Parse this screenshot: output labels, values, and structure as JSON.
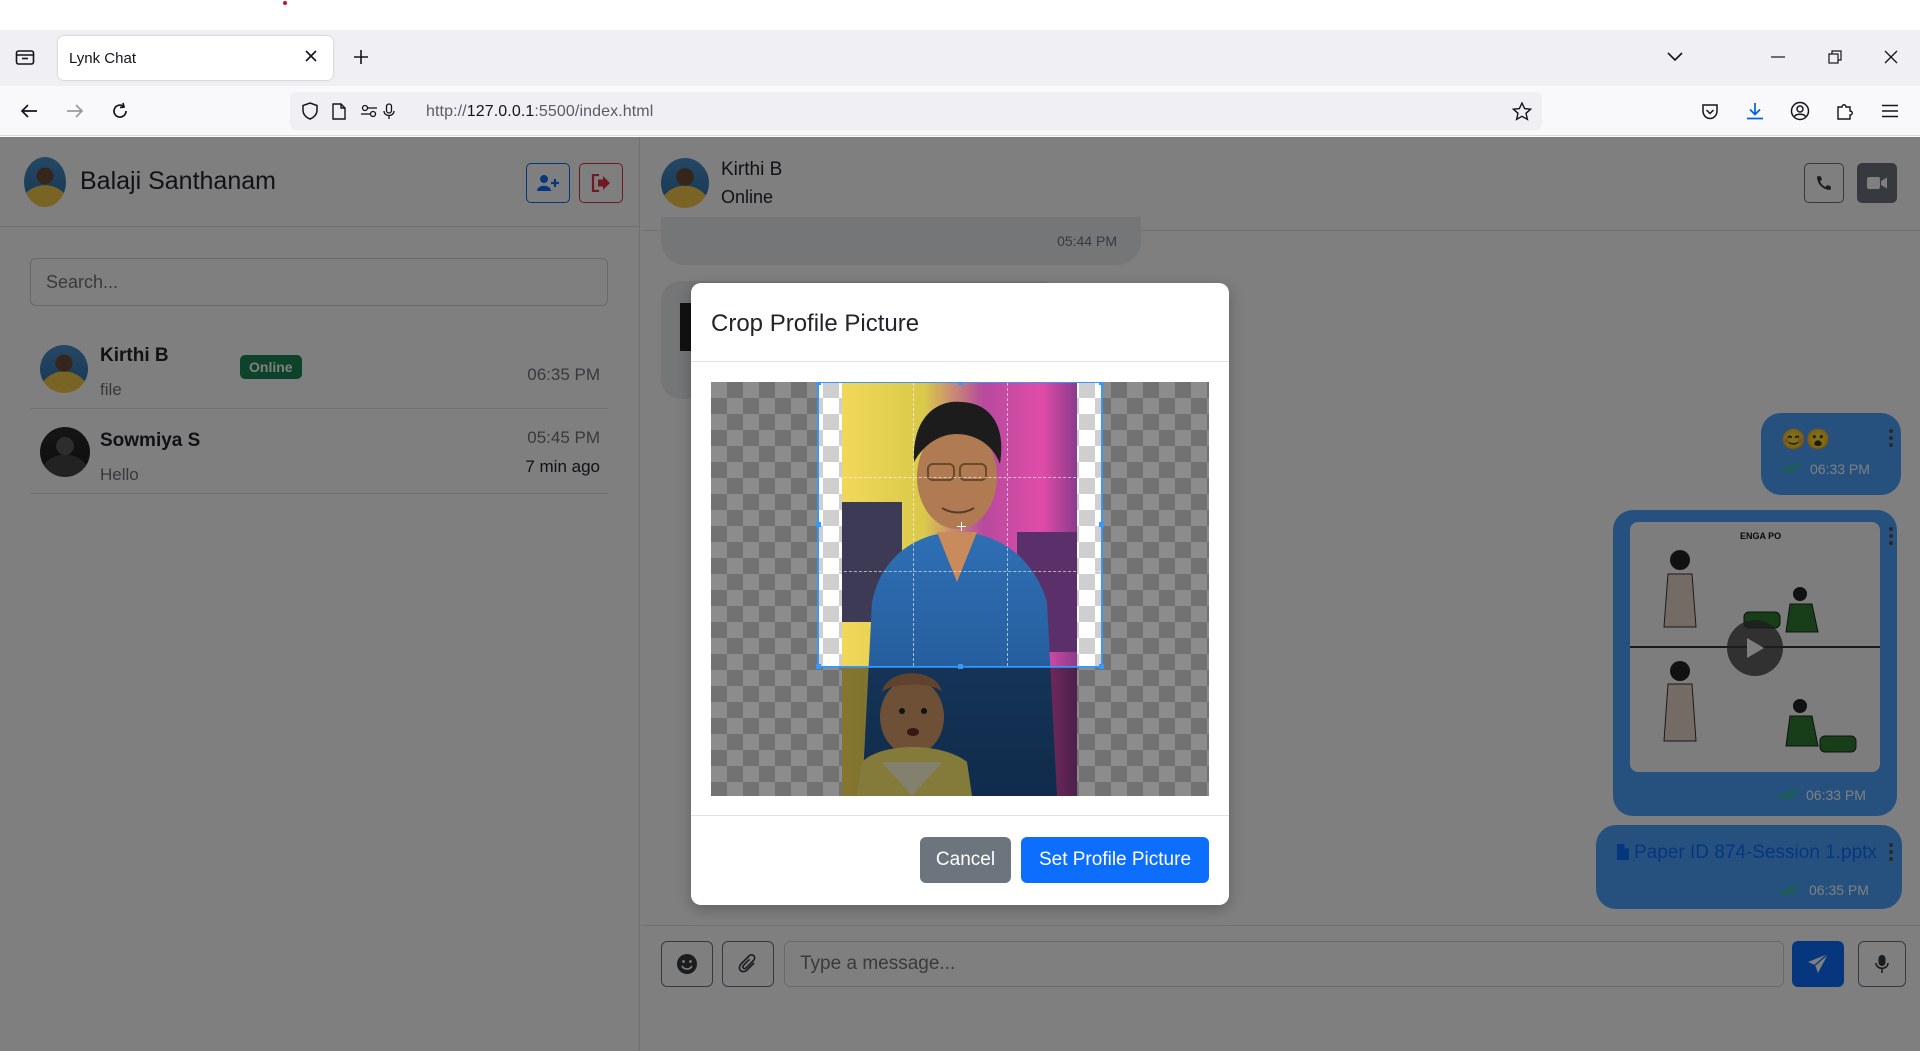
{
  "browser": {
    "tab_title": "Lynk Chat",
    "url_prefix": "http://",
    "url_host": "127.0.0.1",
    "url_rest": ":5500/index.html"
  },
  "sidebar": {
    "user_name": "Balaji Santhanam",
    "search_placeholder": "Search...",
    "contacts": [
      {
        "name": "Kirthi B",
        "badge": "Online",
        "last_message": "file",
        "time": "06:35 PM"
      },
      {
        "name": "Sowmiya S",
        "last_message": "Hello",
        "time": "05:45 PM",
        "ago": "7 min ago"
      }
    ]
  },
  "chat": {
    "peer_name": "Kirthi B",
    "peer_status": "Online",
    "messages": [
      {
        "time": "05:44 PM"
      },
      {
        "text": "😊😮",
        "time": "06:33 PM"
      },
      {
        "video_caption": "ENGA PO",
        "time": "06:33 PM"
      },
      {
        "file_name": "Paper ID 874-Session 1.pptx",
        "time": "06:35 PM"
      }
    ],
    "composer_placeholder": "Type a message..."
  },
  "modal": {
    "title": "Crop Profile Picture",
    "cancel_label": "Cancel",
    "confirm_label": "Set Profile Picture"
  },
  "colors": {
    "primary": "#0d6efd",
    "danger": "#dc3545",
    "success": "#198754",
    "secondary": "#6c757d",
    "outgoing_bubble": "#4da3ff",
    "crop_guide": "#3399ff"
  },
  "icons": [
    "tab-list-icon",
    "close-icon",
    "new-tab-icon",
    "chevron-down-icon",
    "minimize-icon",
    "restore-icon",
    "window-close-icon",
    "back-icon",
    "forward-icon",
    "reload-icon",
    "shield-icon",
    "page-icon",
    "permissions-icon",
    "mic-icon",
    "star-icon",
    "pocket-icon",
    "download-icon",
    "account-icon",
    "extensions-icon",
    "menu-icon",
    "add-user-icon",
    "logout-icon",
    "phone-icon",
    "video-icon",
    "emoji-icon",
    "paperclip-icon",
    "send-icon",
    "microphone-icon",
    "play-icon",
    "file-icon",
    "double-check-icon"
  ]
}
